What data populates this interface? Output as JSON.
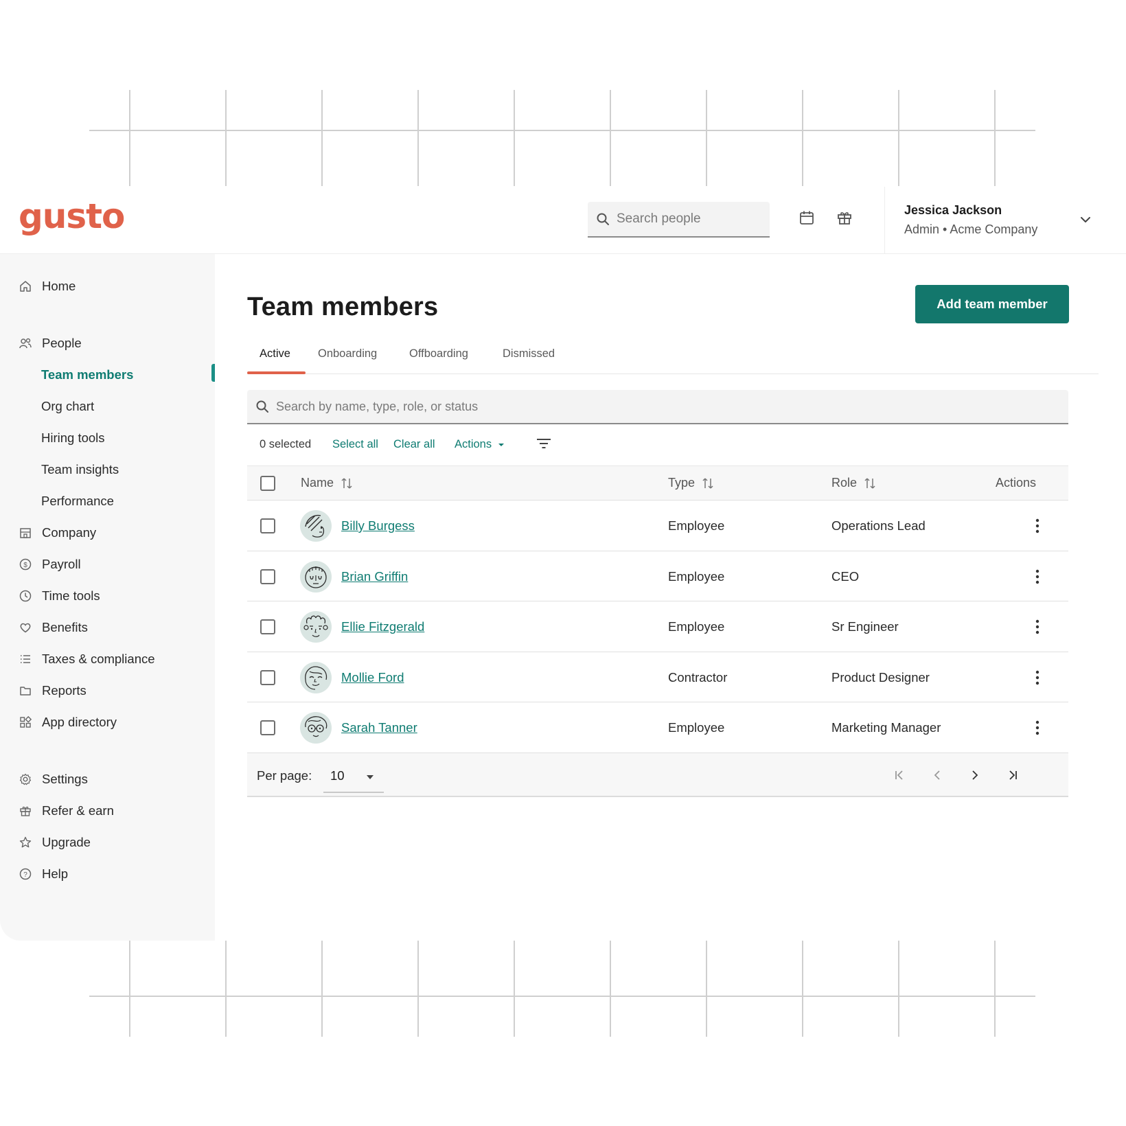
{
  "brand": {
    "logo_text": "gusto",
    "color": "#e0624a",
    "accent": "#13776c"
  },
  "topbar": {
    "search_placeholder": "Search people",
    "icons": [
      "calendar-icon",
      "gift-icon"
    ],
    "user": {
      "name": "Jessica Jackson",
      "role": "Admin • Acme Company"
    }
  },
  "sidebar": {
    "items": [
      {
        "label": "Home",
        "icon": "home-icon"
      },
      {
        "label": "People",
        "icon": "people-icon"
      },
      {
        "label": "Team members",
        "active": true
      },
      {
        "label": "Org chart"
      },
      {
        "label": "Hiring tools"
      },
      {
        "label": "Team insights"
      },
      {
        "label": "Performance"
      },
      {
        "label": "Company",
        "icon": "building-icon"
      },
      {
        "label": "Payroll",
        "icon": "dollar-icon"
      },
      {
        "label": "Time tools",
        "icon": "clock-icon"
      },
      {
        "label": "Benefits",
        "icon": "heart-icon"
      },
      {
        "label": "Taxes & compliance",
        "icon": "list-icon"
      },
      {
        "label": "Reports",
        "icon": "folder-icon"
      },
      {
        "label": "App directory",
        "icon": "apps-icon"
      },
      {
        "label": "Settings",
        "icon": "gear-icon"
      },
      {
        "label": "Refer & earn",
        "icon": "gift-icon"
      },
      {
        "label": "Upgrade",
        "icon": "star-icon"
      },
      {
        "label": "Help",
        "icon": "help-icon"
      }
    ]
  },
  "main": {
    "title": "Team members",
    "add_button": "Add team member",
    "tabs": [
      {
        "label": "Active",
        "active": true
      },
      {
        "label": "Onboarding"
      },
      {
        "label": "Offboarding"
      },
      {
        "label": "Dismissed"
      }
    ],
    "search_placeholder": "Search by name, type, role, or status",
    "bulk": {
      "selected": "0 selected",
      "select_all": "Select all",
      "clear_all": "Clear all",
      "actions": "Actions"
    },
    "table": {
      "columns": [
        "Name",
        "Type",
        "Role",
        "Actions"
      ],
      "rows": [
        {
          "name": "Billy Burgess",
          "type": "Employee",
          "role": "Operations Lead"
        },
        {
          "name": "Brian Griffin",
          "type": "Employee",
          "role": "CEO"
        },
        {
          "name": "Ellie Fitzgerald",
          "type": "Employee",
          "role": "Sr Engineer"
        },
        {
          "name": "Mollie Ford",
          "type": "Contractor",
          "role": "Product Designer"
        },
        {
          "name": "Sarah Tanner",
          "type": "Employee",
          "role": "Marketing Manager"
        }
      ]
    },
    "pagination": {
      "per_page_label": "Per page:",
      "per_page_value": "10"
    }
  }
}
